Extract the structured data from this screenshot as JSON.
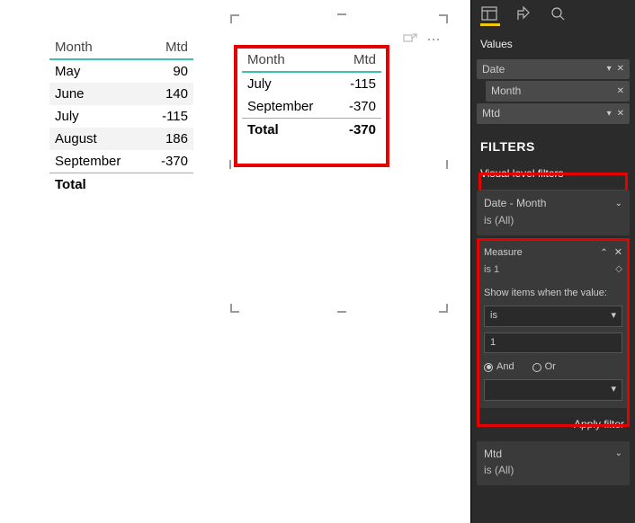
{
  "table_left": {
    "headers": [
      "Month",
      "Mtd"
    ],
    "rows": [
      {
        "month": "May",
        "mtd": "90"
      },
      {
        "month": "June",
        "mtd": "140"
      },
      {
        "month": "July",
        "mtd": "-115"
      },
      {
        "month": "August",
        "mtd": "186"
      },
      {
        "month": "September",
        "mtd": "-370"
      }
    ],
    "total_label": "Total",
    "total_value": ""
  },
  "table_right": {
    "headers": [
      "Month",
      "Mtd"
    ],
    "rows": [
      {
        "month": "July",
        "mtd": "-115"
      },
      {
        "month": "September",
        "mtd": "-370"
      }
    ],
    "total_label": "Total",
    "total_value": "-370"
  },
  "pane": {
    "values_label": "Values",
    "fields": {
      "date": "Date",
      "month": "Month",
      "mtd": "Mtd"
    },
    "filters_label": "FILTERS",
    "visual_filters_label": "Visual level filters",
    "date_month": {
      "title": "Date - Month",
      "sub": "is (All)"
    },
    "measure": {
      "title": "Measure",
      "summary": "is 1",
      "show_label": "Show items when the value:",
      "op": "is",
      "val": "1",
      "and": "And",
      "or": "Or",
      "op2": ""
    },
    "apply_label": "Apply filter",
    "mtd_filter": {
      "title": "Mtd",
      "sub": "is (All)"
    }
  },
  "chart_data": {
    "type": "table",
    "tables": [
      {
        "name": "left",
        "columns": [
          "Month",
          "Mtd"
        ],
        "rows": [
          [
            "May",
            90
          ],
          [
            "June",
            140
          ],
          [
            "July",
            -115
          ],
          [
            "August",
            186
          ],
          [
            "September",
            -370
          ]
        ],
        "total": null
      },
      {
        "name": "right",
        "columns": [
          "Month",
          "Mtd"
        ],
        "rows": [
          [
            "July",
            -115
          ],
          [
            "September",
            -370
          ]
        ],
        "total": -370
      }
    ]
  }
}
